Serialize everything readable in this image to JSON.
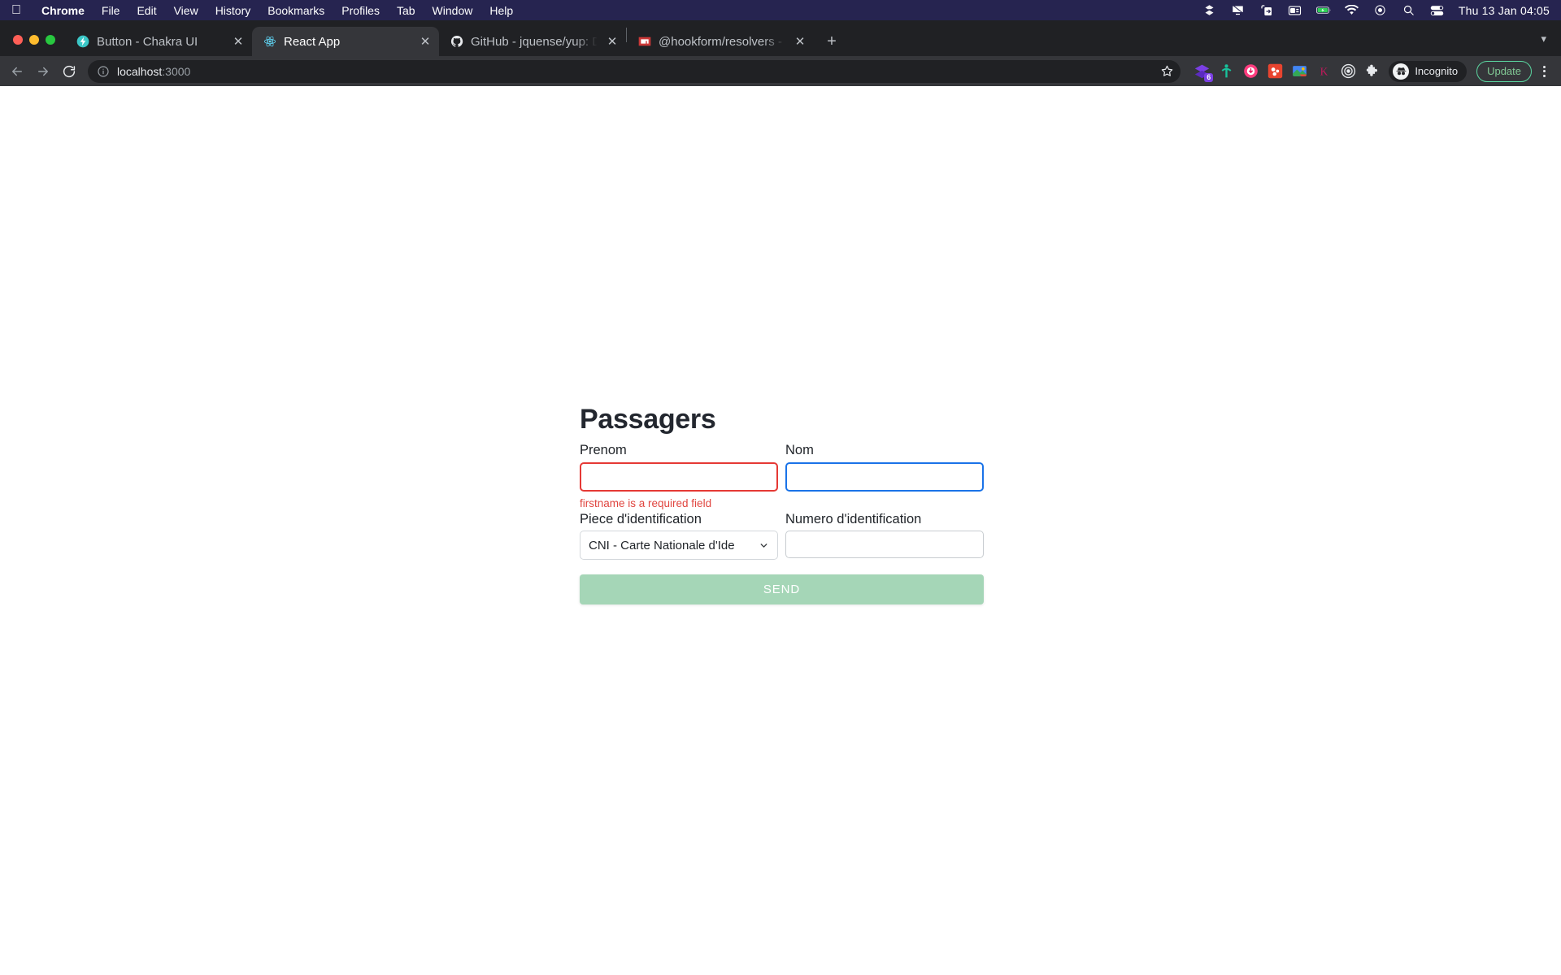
{
  "menubar": {
    "apple": "apple-logo",
    "items": [
      {
        "label": "Chrome",
        "bold": true
      },
      {
        "label": "File",
        "bold": false
      },
      {
        "label": "Edit",
        "bold": false
      },
      {
        "label": "View",
        "bold": false
      },
      {
        "label": "History",
        "bold": false
      },
      {
        "label": "Bookmarks",
        "bold": false
      },
      {
        "label": "Profiles",
        "bold": false
      },
      {
        "label": "Tab",
        "bold": false
      },
      {
        "label": "Window",
        "bold": false
      },
      {
        "label": "Help",
        "bold": false
      }
    ],
    "status_icons": [
      "dropbox-icon",
      "display-mirror-icon",
      "screen-share-icon",
      "widgets-icon",
      "battery-icon",
      "wifi-icon",
      "control-center-icon",
      "spotlight-search-icon",
      "toggles-icon"
    ],
    "clock": "Thu 13 Jan  04:05"
  },
  "browser": {
    "tabs": [
      {
        "title": "Button - Chakra UI",
        "favicon": "chakra-ui-icon",
        "active": false
      },
      {
        "title": "React App",
        "favicon": "react-icon",
        "active": true
      },
      {
        "title": "GitHub - jquense/yup: Dead sin",
        "favicon": "github-icon",
        "active": false
      },
      {
        "title": "@hookform/resolvers - npm",
        "favicon": "npm-icon",
        "active": false
      }
    ],
    "new_tab_label": "+",
    "tablist_chevron": "▾",
    "nav": {
      "back": "←",
      "forward": "→",
      "reload": "reload-icon"
    },
    "omnibox": {
      "site_info_icon": "info-circle-icon",
      "url_host": "localhost",
      "url_port": ":3000",
      "bookmark_icon": "star-icon"
    },
    "extensions": [
      {
        "name": "layers-extension-icon",
        "badge": "6"
      },
      {
        "name": "green-figure-extension-icon",
        "badge": ""
      },
      {
        "name": "pink-circle-extension-icon",
        "badge": ""
      },
      {
        "name": "red-square-extension-icon",
        "badge": ""
      },
      {
        "name": "image-extension-icon",
        "badge": ""
      },
      {
        "name": "k-letter-extension-icon",
        "badge": ""
      },
      {
        "name": "target-extension-icon",
        "badge": ""
      },
      {
        "name": "puzzle-extensions-icon",
        "badge": ""
      }
    ],
    "profile": {
      "label": "Incognito",
      "avatar": "incognito-avatar-icon"
    },
    "update_button": "Update",
    "menu_icon": "three-dot-menu-icon"
  },
  "page": {
    "title": "Passagers",
    "fields": {
      "prenom": {
        "label": "Prenom",
        "value": "",
        "placeholder": "",
        "state": "error",
        "error": "firstname is a required field"
      },
      "nom": {
        "label": "Nom",
        "value": "",
        "placeholder": "",
        "state": "focused"
      },
      "piece": {
        "label": "Piece d'identification",
        "selected": "CNI - Carte Nationale d'Ide",
        "chevron": "chevron-down-icon"
      },
      "numero": {
        "label": "Numero d'identification",
        "value": "",
        "placeholder": ""
      }
    },
    "submit_label": "SEND"
  },
  "colors": {
    "menubar_bg": "#262450",
    "chrome_bg": "#202124",
    "toolbar_bg": "#35363a",
    "error_red": "#e0453f",
    "focus_blue": "#1a73e8",
    "send_green": "#a5d6b7",
    "update_green": "#81c995",
    "heading": "#23272f"
  }
}
